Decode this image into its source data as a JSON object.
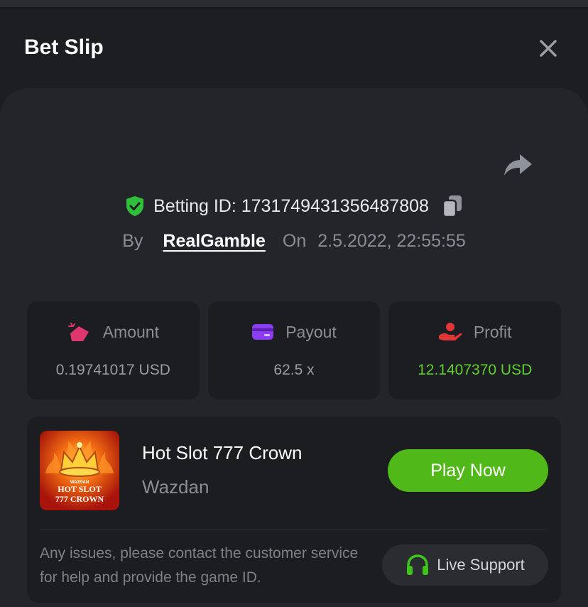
{
  "modal": {
    "title": "Bet Slip"
  },
  "bet": {
    "id_label": "Betting ID: 1731749431356487808",
    "by_label": "By",
    "username": "RealGamble",
    "on_label": "On",
    "datetime": "2.5.2022, 22:55:55"
  },
  "stats": [
    {
      "label": "Amount",
      "value": "0.19741017 USD",
      "icon": "amount-icon",
      "color": "#e0366f"
    },
    {
      "label": "Payout",
      "value": "62.5 x",
      "icon": "payout-wallet-icon",
      "color": "#8a3df2"
    },
    {
      "label": "Profit",
      "value": "12.1407370 USD",
      "icon": "profit-hand-icon",
      "color": "#e03636"
    }
  ],
  "game": {
    "name": "Hot Slot 777 Crown",
    "provider": "Wazdan",
    "thumb_brand": "WAZDAN",
    "thumb_title_1": "HOT SLOT",
    "thumb_title_2": "777 CROWN",
    "play_label": "Play Now"
  },
  "support": {
    "help_text": "Any issues, please contact the customer service for help and provide the game ID.",
    "button_label": "Live Support"
  },
  "colors": {
    "accent_green": "#50b818",
    "profit_green": "#5fcf2d",
    "verified_green": "#2fbf3a",
    "background": "#1c1e22",
    "card": "#23252a"
  }
}
